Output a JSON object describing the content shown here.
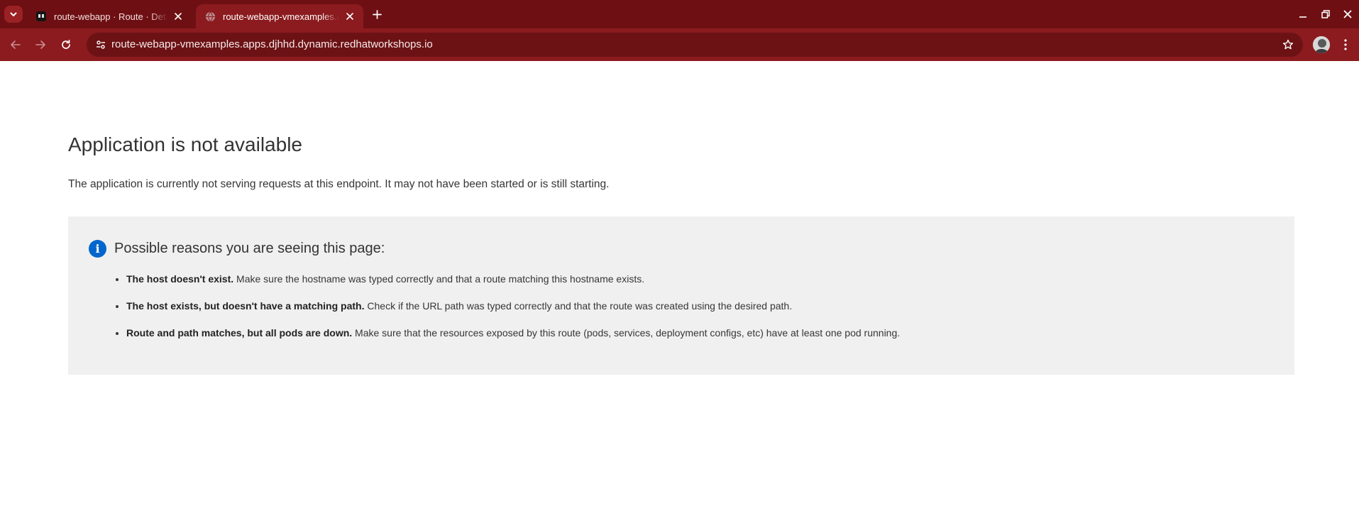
{
  "browser": {
    "tabs": [
      {
        "title": "route-webapp · Route · Details · ",
        "active": false
      },
      {
        "title": "route-webapp-vmexamples.apps.djhhd.dynamic.redhatworkshops.io",
        "active": true
      }
    ],
    "url": "route-webapp-vmexamples.apps.djhhd.dynamic.redhatworkshops.io",
    "colors": {
      "tabstrip": "#6e1013",
      "toolbar": "#8b1b1e",
      "omnibox": "#6c1215"
    }
  },
  "page": {
    "title": "Application is not available",
    "lead": "The application is currently not serving requests at this endpoint. It may not have been started or is still starting.",
    "reasons": {
      "heading": "Possible reasons you are seeing this page:",
      "items": [
        {
          "bold": "The host doesn't exist.",
          "text": " Make sure the hostname was typed correctly and that a route matching this hostname exists."
        },
        {
          "bold": "The host exists, but doesn't have a matching path.",
          "text": " Check if the URL path was typed correctly and that the route was created using the desired path."
        },
        {
          "bold": "Route and path matches, but all pods are down.",
          "text": " Make sure that the resources exposed by this route (pods, services, deployment configs, etc) have at least one pod running."
        }
      ]
    },
    "colors": {
      "info_icon": "#0066cc",
      "panel_bg": "#f0f0f0"
    }
  }
}
